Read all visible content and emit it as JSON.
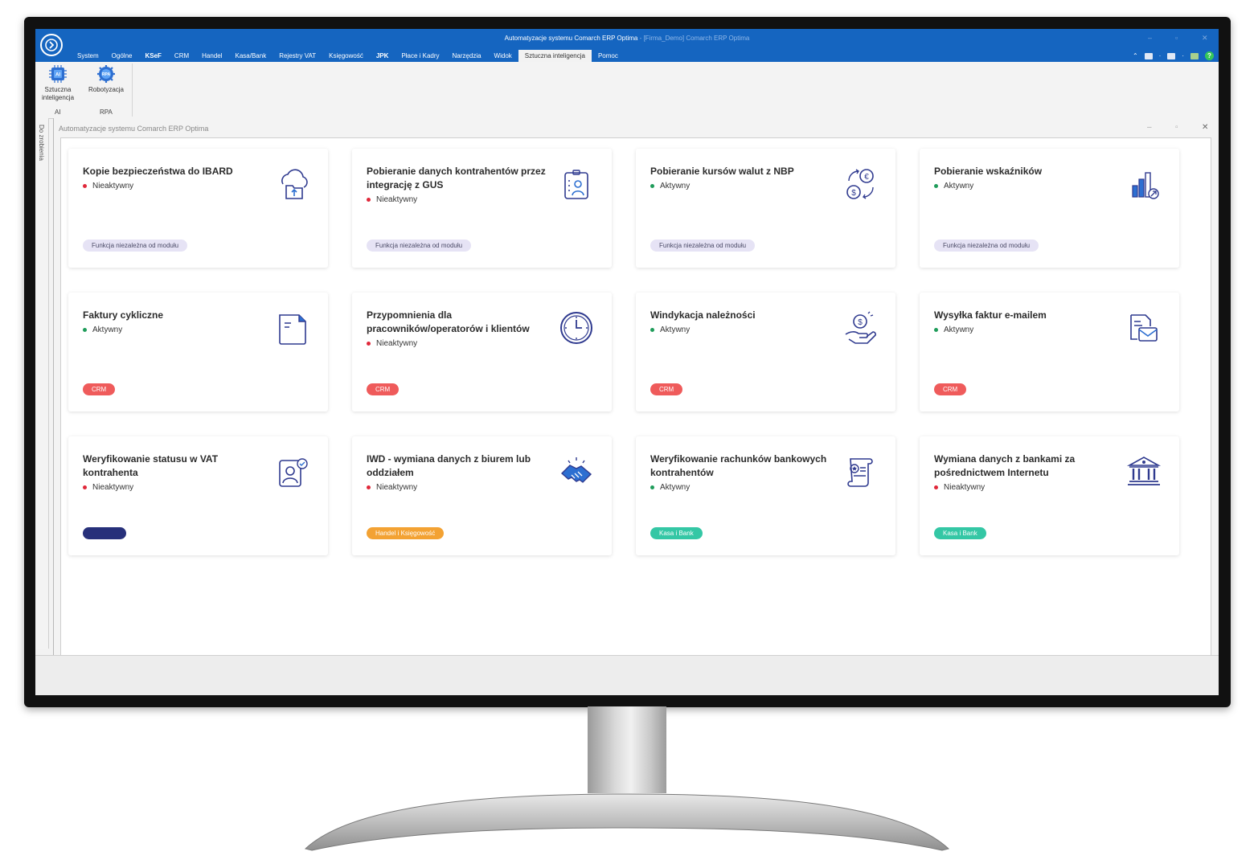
{
  "window": {
    "title_main": "Automatyzacje systemu Comarch ERP Optima",
    "title_rest": " - [Firma_Demo] Comarch ERP Optima"
  },
  "menu": [
    {
      "label": "System",
      "bold": false,
      "active": false
    },
    {
      "label": "Ogólne",
      "bold": false,
      "active": false
    },
    {
      "label": "KSeF",
      "bold": true,
      "active": false
    },
    {
      "label": "CRM",
      "bold": false,
      "active": false
    },
    {
      "label": "Handel",
      "bold": false,
      "active": false
    },
    {
      "label": "Kasa/Bank",
      "bold": false,
      "active": false
    },
    {
      "label": "Rejestry VAT",
      "bold": false,
      "active": false
    },
    {
      "label": "Księgowość",
      "bold": false,
      "active": false
    },
    {
      "label": "JPK",
      "bold": true,
      "active": false
    },
    {
      "label": "Płace i Kadry",
      "bold": false,
      "active": false
    },
    {
      "label": "Narzędzia",
      "bold": false,
      "active": false
    },
    {
      "label": "Widok",
      "bold": false,
      "active": false
    },
    {
      "label": "Sztuczna inteligencja",
      "bold": false,
      "active": true
    },
    {
      "label": "Pomoc",
      "bold": false,
      "active": false
    }
  ],
  "ribbon": {
    "ai_button_line1": "Sztuczna",
    "ai_button_line2": "inteligencja",
    "ai_group": "AI",
    "rpa_button": "Robotyzacja",
    "rpa_group": "RPA"
  },
  "sidebar": {
    "label": "Do zrobienia"
  },
  "document": {
    "title": "Automatyzacje systemu Comarch ERP Optima"
  },
  "colors": {
    "title_bar": "#1565c0",
    "icon_stroke": "#2f3a8f",
    "tag_neutral_bg": "#e6e3f5",
    "tag_crm_bg": "#ef5b5b",
    "tag_navy_bg": "#27307a",
    "tag_orange_bg": "#f3a233",
    "tag_teal_bg": "#34c7a5"
  },
  "cards": [
    {
      "title": "Kopie bezpieczeństwa do IBARD",
      "status": "Nieaktywny",
      "active": false,
      "tag": "Funkcja niezależna od modułu",
      "tag_style": "neutral",
      "icon": "cloud-folder-icon"
    },
    {
      "title": "Pobieranie danych kontrahentów przez integrację z GUS",
      "status": "Nieaktywny",
      "active": false,
      "tag": "Funkcja niezależna od modułu",
      "tag_style": "neutral",
      "icon": "id-badge-icon"
    },
    {
      "title": "Pobieranie kursów walut z NBP",
      "status": "Aktywny",
      "active": true,
      "tag": "Funkcja niezależna od modułu",
      "tag_style": "neutral",
      "icon": "currency-exchange-icon"
    },
    {
      "title": "Pobieranie wskaźników",
      "status": "Aktywny",
      "active": true,
      "tag": "Funkcja niezależna od modułu",
      "tag_style": "neutral",
      "icon": "bar-chart-icon"
    },
    {
      "title": "Faktury cykliczne",
      "status": "Aktywny",
      "active": true,
      "tag": "CRM",
      "tag_style": "crm",
      "icon": "document-icon"
    },
    {
      "title": "Przypomnienia dla pracowników/operatorów i klientów",
      "status": "Nieaktywny",
      "active": false,
      "tag": "CRM",
      "tag_style": "crm",
      "icon": "clock-icon"
    },
    {
      "title": "Windykacja należności",
      "status": "Aktywny",
      "active": true,
      "tag": "CRM",
      "tag_style": "crm",
      "icon": "hand-coin-icon"
    },
    {
      "title": "Wysyłka faktur e-mailem",
      "status": "Aktywny",
      "active": true,
      "tag": "CRM",
      "tag_style": "crm",
      "icon": "invoice-mail-icon"
    },
    {
      "title": "Weryfikowanie statusu w VAT kontrahenta",
      "status": "Nieaktywny",
      "active": false,
      "tag": "",
      "tag_style": "navy",
      "icon": "person-verify-icon"
    },
    {
      "title": "IWD - wymiana danych z biurem lub oddziałem",
      "status": "Nieaktywny",
      "active": false,
      "tag": "Handel i Księgowość",
      "tag_style": "orange",
      "icon": "handshake-icon"
    },
    {
      "title": "Weryfikowanie rachunków bankowych kontrahentów",
      "status": "Aktywny",
      "active": true,
      "tag": "Kasa i Bank",
      "tag_style": "teal",
      "icon": "scroll-certificate-icon"
    },
    {
      "title": "Wymiana danych z bankami za pośrednictwem Internetu",
      "status": "Nieaktywny",
      "active": false,
      "tag": "Kasa i Bank",
      "tag_style": "teal",
      "icon": "bank-icon"
    }
  ]
}
